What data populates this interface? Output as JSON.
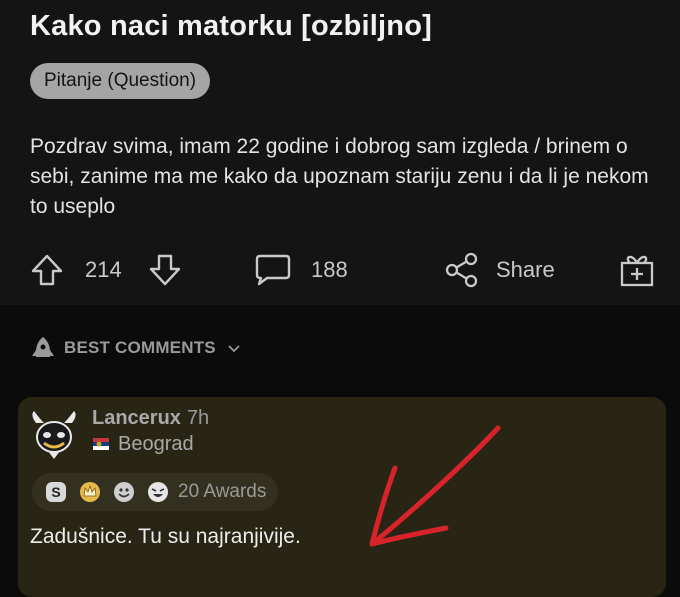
{
  "post": {
    "title": "Kako naci matorku [ozbiljno]",
    "flair": "Pitanje (Question)",
    "body": "Pozdrav svima, imam 22 godine i dobrog sam izgleda / brinem o sebi, zanime ma me kako da upoznam stariju zenu i da li je nekom to useplo",
    "actions": {
      "upvotes": "214",
      "comments": "188",
      "share_label": "Share"
    }
  },
  "sort": {
    "label": "BEST COMMENTS"
  },
  "comment": {
    "author": "Lancerux",
    "time": "7h",
    "user_flair": "Beograd",
    "awards_label": "20 Awards",
    "text": "Zadušnice. Tu su najranjivije."
  },
  "colors": {
    "background": "#0b0b0b",
    "post_background": "#141414",
    "flair_background": "#a5a5a5",
    "comment_highlight": "#292515",
    "annotation_arrow": "#d8232a"
  },
  "icons": [
    "upvote-icon",
    "downvote-icon",
    "comment-icon",
    "share-icon",
    "award-icon",
    "rocket-icon",
    "chevron-down-icon",
    "flag-icon"
  ]
}
